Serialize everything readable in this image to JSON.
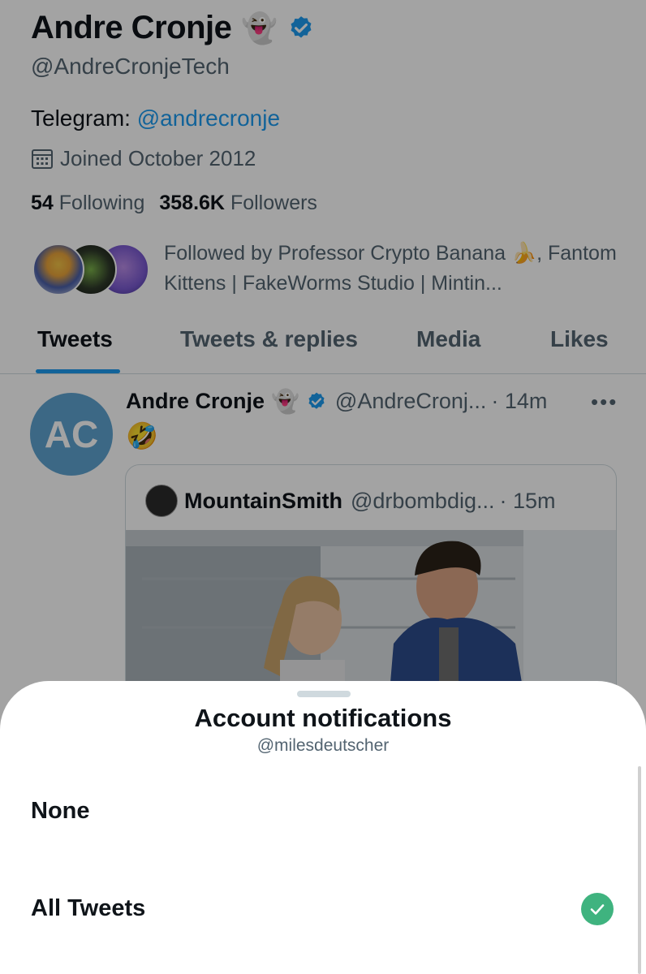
{
  "profile": {
    "name": "Andre Cronje",
    "ghost_emoji": "👻",
    "verified": "verified-badge",
    "handle": "@AndreCronjeTech",
    "bio_prefix": "Telegram: ",
    "bio_link": "@andrecronje",
    "joined": "Joined October 2012",
    "following_count": "54",
    "following_label": "Following",
    "followers_count": "358.6K",
    "followers_label": "Followers",
    "followed_by": "Followed by Professor Crypto Banana 🍌, Fantom Kittens | FakeWorms Studio | Mintin..."
  },
  "tabs": [
    {
      "label": "Tweets",
      "active": true
    },
    {
      "label": "Tweets & replies",
      "active": false
    },
    {
      "label": "Media",
      "active": false
    },
    {
      "label": "Likes",
      "active": false
    }
  ],
  "tweet": {
    "avatar_initials": "AC",
    "name": "Andre Cronje",
    "ghost_emoji": "👻",
    "handle": "@AndreCronj...",
    "time": "· 14m",
    "more": "•••",
    "content": "🤣",
    "quote": {
      "name": "MountainSmith",
      "handle": "@drbombdig...",
      "time": "· 15m"
    }
  },
  "sheet": {
    "title": "Account notifications",
    "subtitle": "@milesdeutscher",
    "options": [
      {
        "label": "None",
        "selected": false
      },
      {
        "label": "All Tweets",
        "selected": true
      }
    ]
  },
  "colors": {
    "accent": "#1d9bf0",
    "check": "#3fb37f",
    "secondary_text": "#536471"
  }
}
